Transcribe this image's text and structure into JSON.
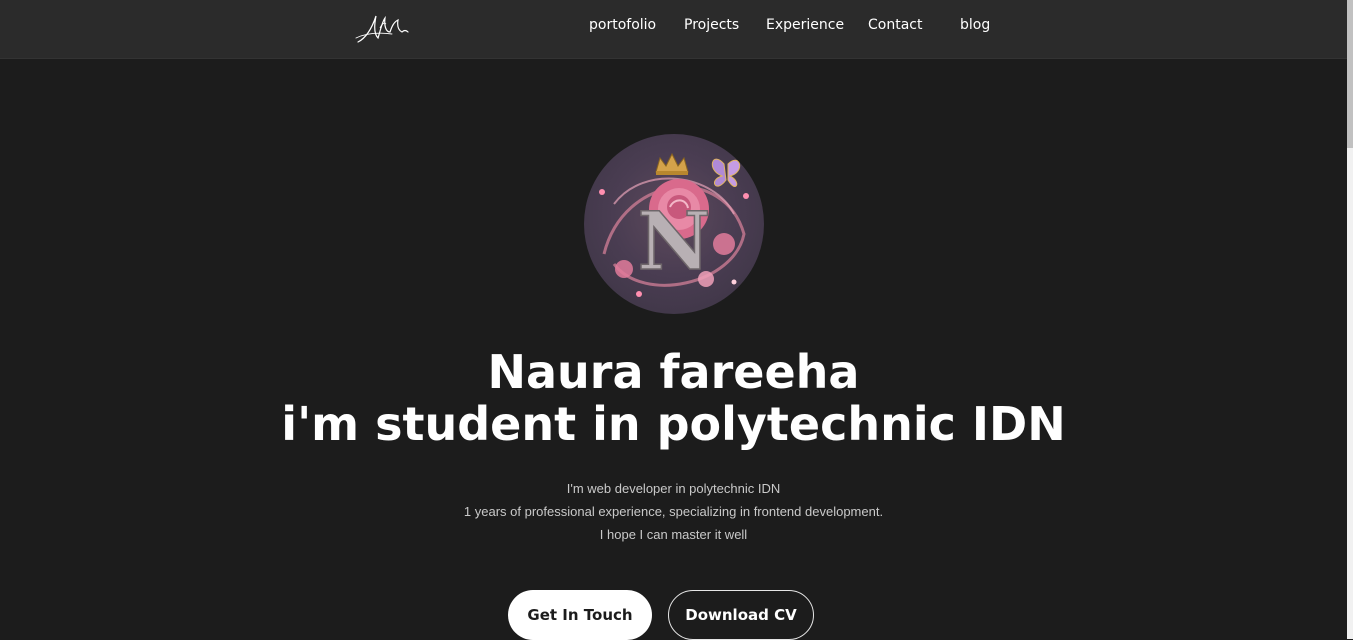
{
  "nav": {
    "links": [
      "portofolio",
      "Projects",
      "Experience",
      "Contact",
      "blog"
    ]
  },
  "hero": {
    "name": "Naura fareeha",
    "tagline": "i'm student in polytechnic IDN",
    "description": [
      "I'm web developer in polytechnic IDN",
      "1 years of professional experience, specializing in frontend development.",
      "I hope I can master it well"
    ],
    "avatar_letter": "N",
    "primary_button": "Get In Touch",
    "secondary_button": "Download CV"
  },
  "colors": {
    "background": "#1c1c1c",
    "navbar": "#2b2b2b",
    "text": "#ffffff",
    "muted_text": "#c9c9c9",
    "accent_pink": "#e07a9a"
  }
}
